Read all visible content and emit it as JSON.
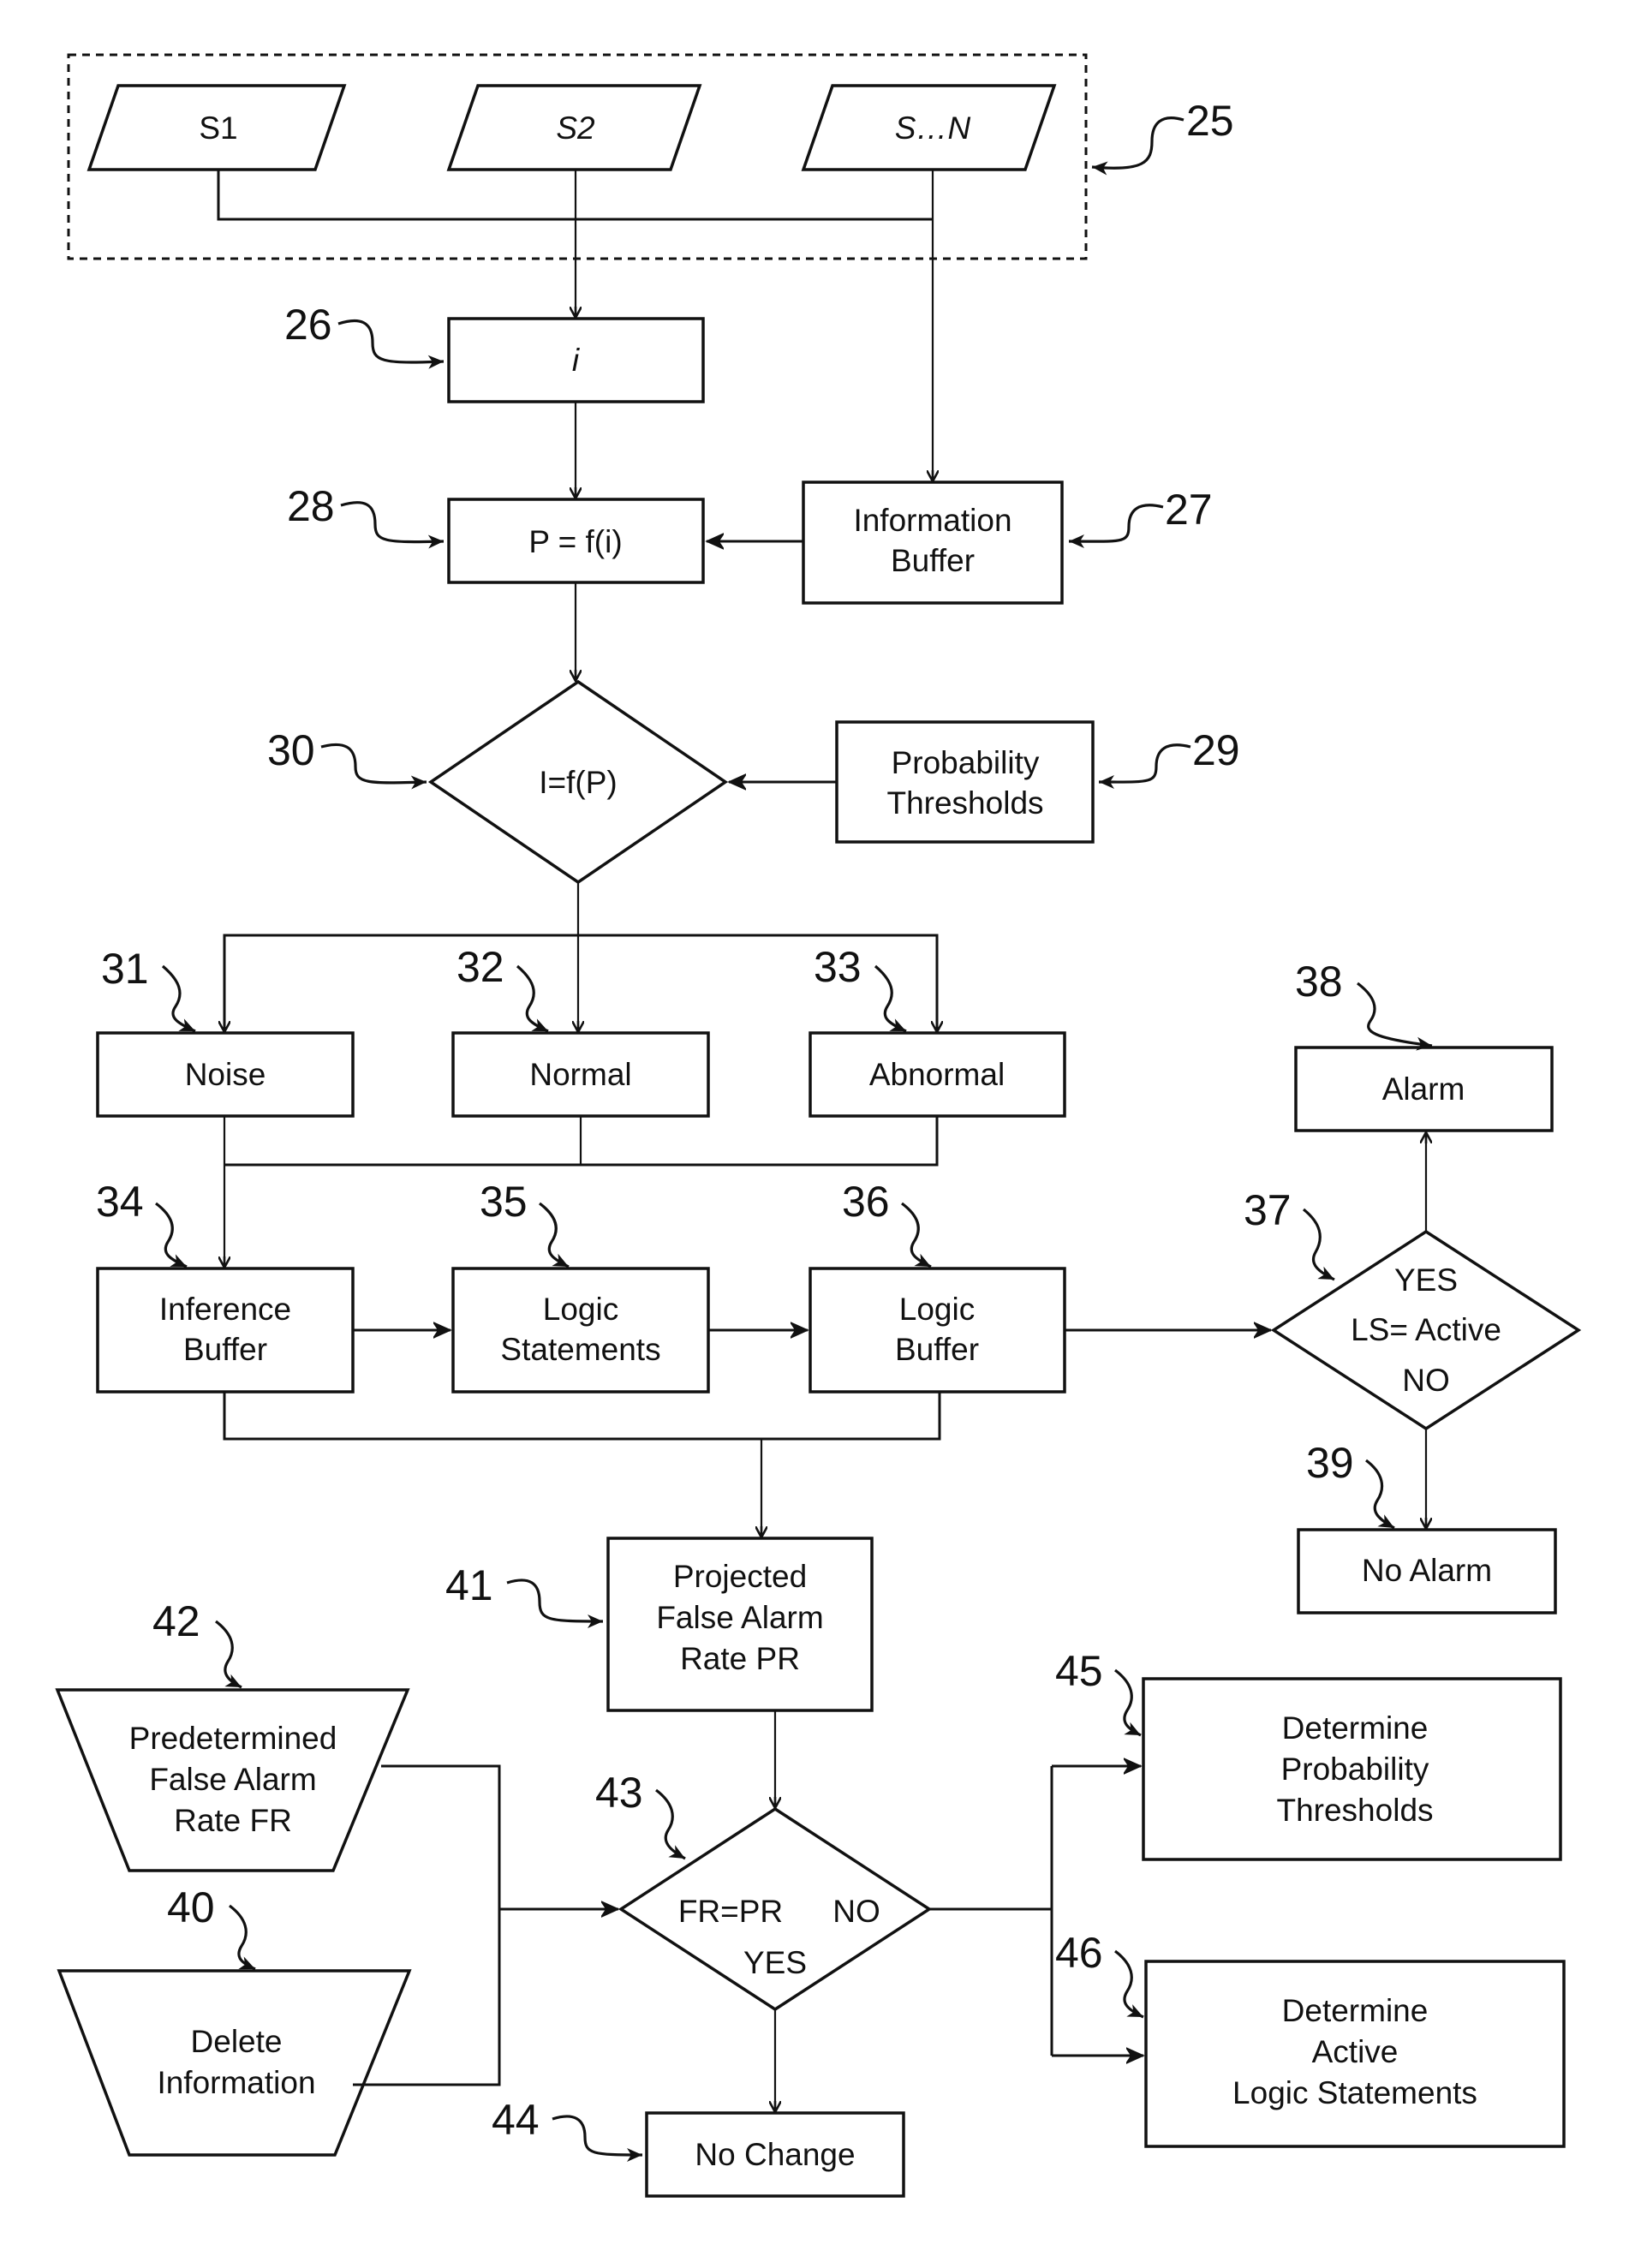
{
  "figure": {
    "group_label": "25",
    "sensors": [
      {
        "id": "s1",
        "label": "S1"
      },
      {
        "id": "s2",
        "label": "S2"
      },
      {
        "id": "sn",
        "label": "S…N"
      }
    ],
    "nodes": {
      "info_input": {
        "ref": "26",
        "label": "i"
      },
      "information_buffer": {
        "ref": "27",
        "lines": [
          "Information",
          "Buffer"
        ]
      },
      "probability_function": {
        "ref": "28",
        "label": "P = f(i)"
      },
      "probability_thresholds": {
        "ref": "29",
        "lines": [
          "Probability",
          "Thresholds"
        ]
      },
      "inference_decision": {
        "ref": "30",
        "label": "I=f(P)"
      },
      "noise": {
        "ref": "31",
        "label": "Noise"
      },
      "normal": {
        "ref": "32",
        "label": "Normal"
      },
      "abnormal": {
        "ref": "33",
        "label": "Abnormal"
      },
      "inference_buffer": {
        "ref": "34",
        "lines": [
          "Inference",
          "Buffer"
        ]
      },
      "logic_statements": {
        "ref": "35",
        "lines": [
          "Logic",
          "Statements"
        ]
      },
      "logic_buffer": {
        "ref": "36",
        "lines": [
          "Logic",
          "Buffer"
        ]
      },
      "ls_decision": {
        "ref": "37",
        "yes": "YES",
        "label": "LS= Active",
        "no": "NO"
      },
      "alarm": {
        "ref": "38",
        "label": "Alarm"
      },
      "no_alarm": {
        "ref": "39",
        "label": "No Alarm"
      },
      "delete_information": {
        "ref": "40",
        "lines": [
          "Delete",
          "Information"
        ]
      },
      "projected_far": {
        "ref": "41",
        "lines": [
          "Projected",
          "False Alarm",
          "Rate PR"
        ]
      },
      "predetermined_far": {
        "ref": "42",
        "lines": [
          "Predetermined",
          "False Alarm",
          "Rate FR"
        ]
      },
      "far_decision": {
        "ref": "43",
        "label": "FR=PR",
        "no": "NO",
        "yes": "YES"
      },
      "no_change": {
        "ref": "44",
        "label": "No Change"
      },
      "determine_thresholds": {
        "ref": "45",
        "lines": [
          "Determine",
          "Probability",
          "Thresholds"
        ]
      },
      "determine_active_ls": {
        "ref": "46",
        "lines": [
          "Determine",
          "Active",
          "Logic Statements"
        ]
      }
    }
  }
}
